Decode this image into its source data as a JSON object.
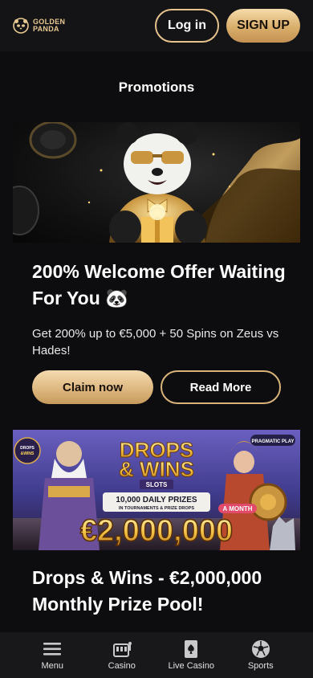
{
  "header": {
    "logo_line1": "GOLDEN",
    "logo_line2": "PANDA",
    "login_label": "Log in",
    "signup_label": "SIGN UP"
  },
  "page": {
    "title": "Promotions"
  },
  "promos": [
    {
      "title": "200% Welcome Offer Waiting For You 🐼",
      "description": "Get 200% up to €5,000 + 50 Spins on Zeus vs Hades!",
      "claim_label": "Claim now",
      "read_label": "Read More"
    },
    {
      "title": "Drops & Wins - €2,000,000 Monthly Prize Pool!",
      "banner": {
        "badge": "DROPS & WINS",
        "headline_1": "DROPS",
        "headline_2": "& WINS",
        "slots": "SLOTS",
        "provider": "PRAGMATIC PLAY",
        "daily": "10,000 DAILY PRIZES",
        "sub": "IN TOURNAMENTS & PRIZE DROPS",
        "month": "A MONTH",
        "amount": "€2,000,000"
      }
    }
  ],
  "nav": [
    {
      "label": "Menu",
      "icon": "menu-icon"
    },
    {
      "label": "Casino",
      "icon": "casino-icon"
    },
    {
      "label": "Live Casino",
      "icon": "cards-icon"
    },
    {
      "label": "Sports",
      "icon": "soccer-ball-icon"
    }
  ],
  "colors": {
    "gold": "#e6c38c",
    "background": "#0d0d0f",
    "header": "#141416"
  }
}
